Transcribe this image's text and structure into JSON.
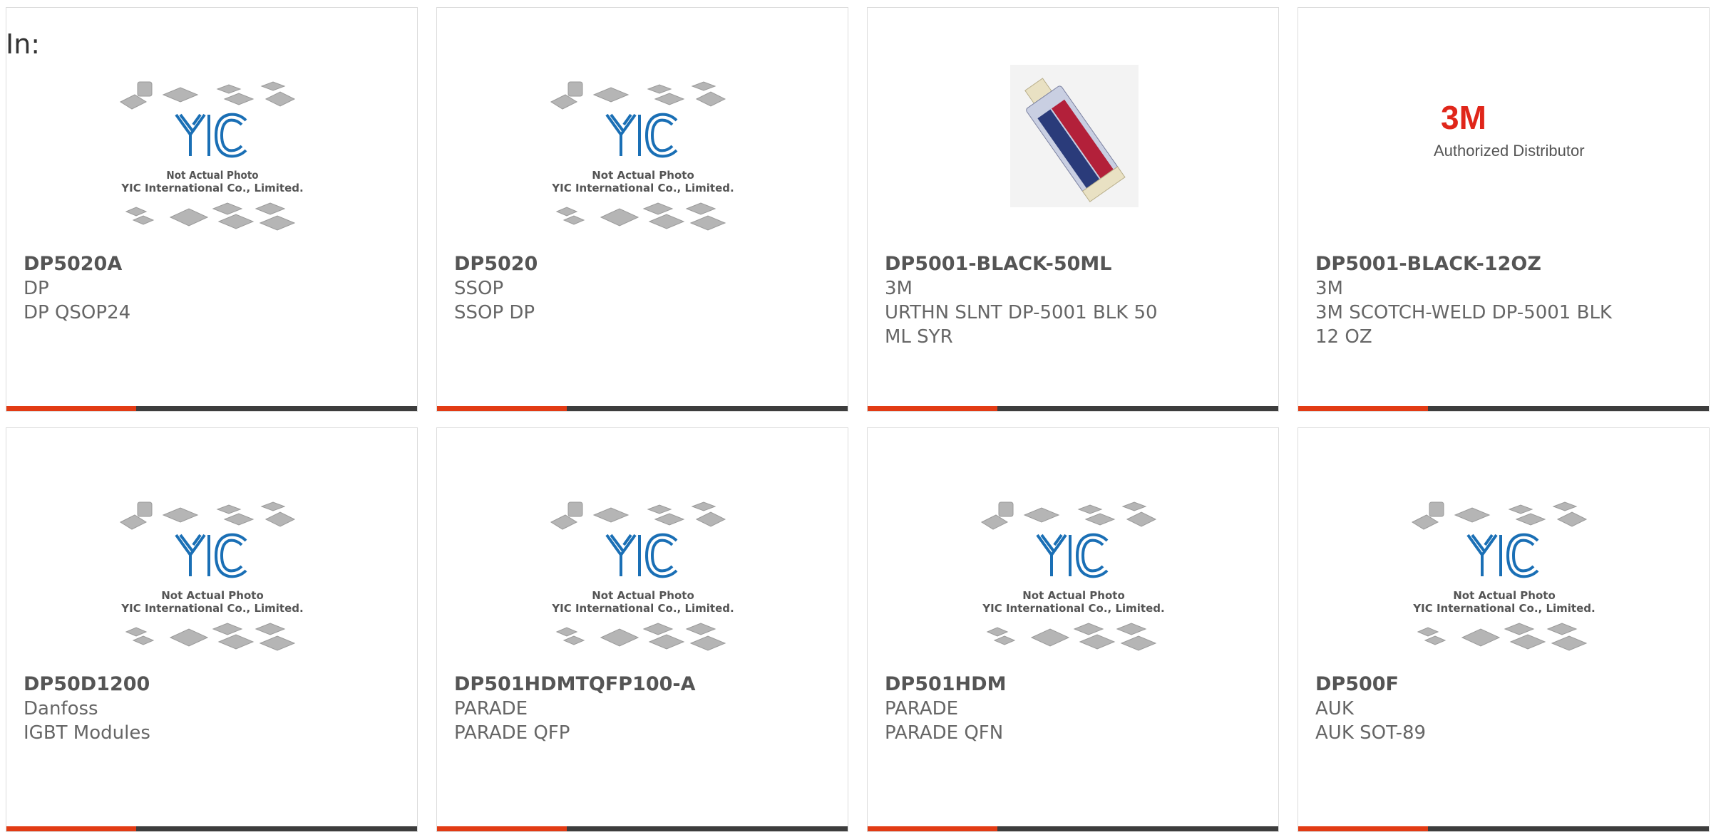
{
  "header": {
    "in_label": "In:"
  },
  "placeholder": {
    "line1": "Not Actual Photo",
    "line2": "YIC International Co., Limited.",
    "logo": "YIC"
  },
  "brand_3m": {
    "logo": "3M",
    "tagline": "Authorized Distributor"
  },
  "colors": {
    "accent": "#e23b14",
    "bar": "#3d3d3d",
    "logo_blue": "#1a6fb5",
    "logo_red": "#e0261a"
  },
  "products": [
    {
      "part": "DP5020A",
      "mfr": "DP",
      "desc": "DP QSOP24",
      "image": "placeholder"
    },
    {
      "part": "DP5020",
      "mfr": "SSOP",
      "desc": "SSOP DP",
      "image": "placeholder"
    },
    {
      "part": "DP5001-BLACK-50ML",
      "mfr": "3M",
      "desc": "URTHN SLNT DP-5001 BLK 50 ML SYR",
      "image": "cartridge"
    },
    {
      "part": "DP5001-BLACK-12OZ",
      "mfr": "3M",
      "desc": "3M SCOTCH-WELD DP-5001 BLK 12 OZ",
      "image": "3m-logo"
    },
    {
      "part": "DP50D1200",
      "mfr": "Danfoss",
      "desc": "IGBT Modules",
      "image": "placeholder"
    },
    {
      "part": "DP501HDMTQFP100-A",
      "mfr": "PARADE",
      "desc": "PARADE QFP",
      "image": "placeholder"
    },
    {
      "part": "DP501HDM",
      "mfr": "PARADE",
      "desc": "PARADE QFN",
      "image": "placeholder"
    },
    {
      "part": "DP500F",
      "mfr": "AUK",
      "desc": "AUK SOT-89",
      "image": "placeholder"
    }
  ]
}
